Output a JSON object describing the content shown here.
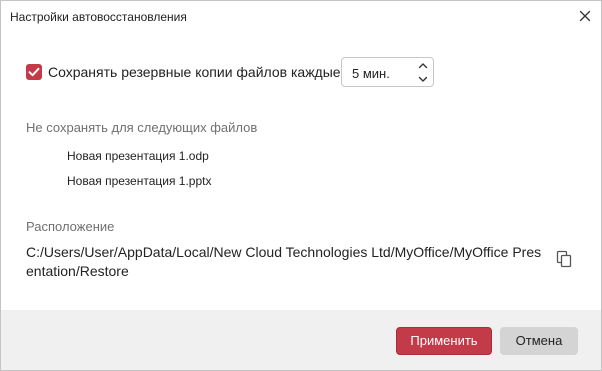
{
  "dialog": {
    "title": "Настройки автовосстановления",
    "close_icon": "close-icon"
  },
  "autosave": {
    "checked": true,
    "label": "Сохранять резервные копии файлов каждые",
    "interval_value": "5 мин.",
    "checkbox_color": "#c33a48"
  },
  "exclusions": {
    "label": "Не сохранять для следующих файлов",
    "files": [
      "Новая презентация 1.odp",
      "Новая презентация 1.pptx"
    ]
  },
  "location": {
    "label": "Расположение",
    "path": "C:/Users/User/AppData/Local/New Cloud Technologies Ltd/MyOffice/MyOffice Presentation/Restore",
    "copy_icon": "copy-icon"
  },
  "footer": {
    "apply_label": "Применить",
    "cancel_label": "Отмена",
    "accent_color": "#c33a48"
  }
}
